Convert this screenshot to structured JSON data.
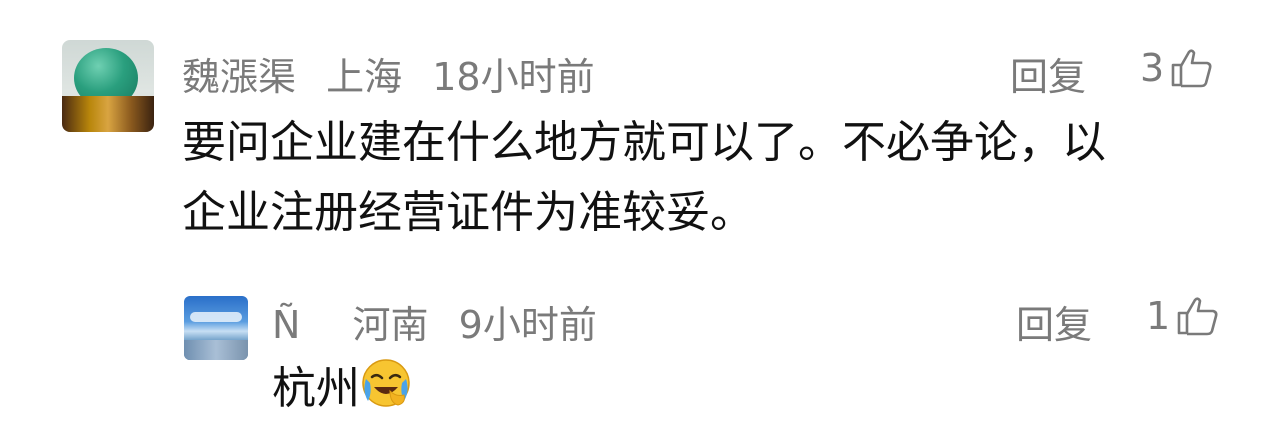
{
  "comment": {
    "author": "魏漲渠",
    "location": "上海",
    "time": "18小时前",
    "text_line1": "要问企业建在什么地方就可以了。不必争论，以",
    "text_line2": "企业注册经营证件为准较妥。",
    "reply_label": "回复",
    "likes": "3",
    "avatar_icon": "green-jade-ball-avatar"
  },
  "reply": {
    "author": "Ñ",
    "location": "河南",
    "time": "9小时前",
    "text": "杭州",
    "emoji": "crying-laughing-emoji",
    "reply_label": "回复",
    "likes": "1",
    "avatar_icon": "lake-landscape-avatar"
  },
  "icons": {
    "like": "thumbs-up-icon"
  },
  "colors": {
    "meta": "#7a7a7a",
    "text": "#111111"
  }
}
